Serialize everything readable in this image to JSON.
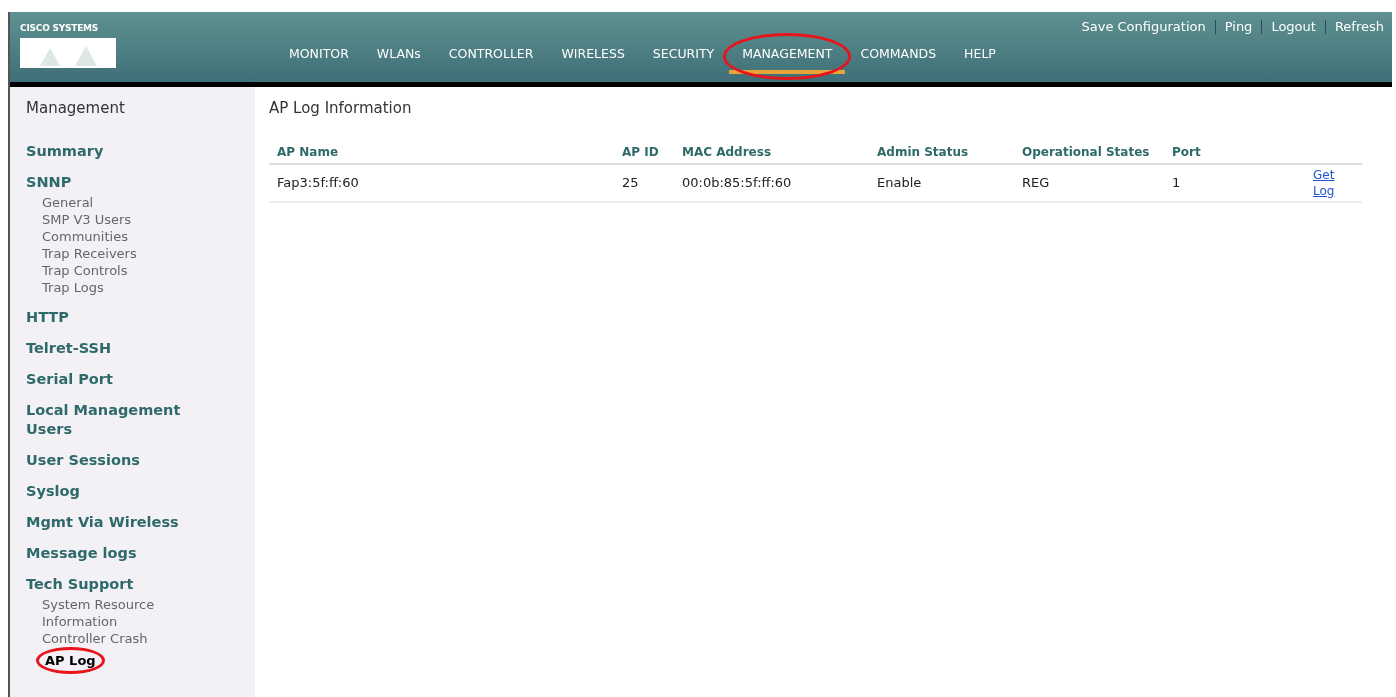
{
  "header": {
    "logo_text": "CISCO SYSTEMS",
    "top_links": [
      "Save Configuration",
      "Ping",
      "Logout",
      "Refresh"
    ],
    "nav": [
      {
        "label": "MONITOR",
        "selected": false
      },
      {
        "label": "WLANs",
        "selected": false
      },
      {
        "label": "CONTROLLER",
        "selected": false
      },
      {
        "label": "WIRELESS",
        "selected": false
      },
      {
        "label": "SECURITY",
        "selected": false
      },
      {
        "label": "MANAGEMENT",
        "selected": true,
        "circled": true
      },
      {
        "label": "COMMANDS",
        "selected": false
      },
      {
        "label": "HELP",
        "selected": false
      }
    ]
  },
  "sidebar": {
    "title": "Management",
    "items": [
      {
        "label": "Summary"
      },
      {
        "label": "SNNP",
        "children": [
          {
            "label": "General"
          },
          {
            "label": "SMP V3 Users"
          },
          {
            "label": "Communities"
          },
          {
            "label": "Trap Receivers"
          },
          {
            "label": "Trap Controls"
          },
          {
            "label": "Trap Logs"
          }
        ]
      },
      {
        "label": "HTTP"
      },
      {
        "label": "Telret-SSH"
      },
      {
        "label": "Serial Port"
      },
      {
        "label": "Local Management Users"
      },
      {
        "label": "User Sessions"
      },
      {
        "label": "Syslog"
      },
      {
        "label": "Mgmt Via Wireless"
      },
      {
        "label": "Message logs"
      },
      {
        "label": "Tech Support",
        "children": [
          {
            "label": "System Resource Information"
          },
          {
            "label": "Controller Crash"
          },
          {
            "label": "AP Log",
            "circled": true
          }
        ]
      }
    ]
  },
  "main": {
    "title": "AP Log Information",
    "table": {
      "columns": [
        "AP Name",
        "AP ID",
        "MAC Address",
        "Admin Status",
        "Operational States",
        "Port"
      ],
      "rows": [
        {
          "cells": [
            "Fap3:5f:ff:60",
            "25",
            "00:0b:85:5f:ff:60",
            "Enable",
            "REG",
            "1"
          ],
          "action": "Get Log"
        }
      ]
    }
  }
}
